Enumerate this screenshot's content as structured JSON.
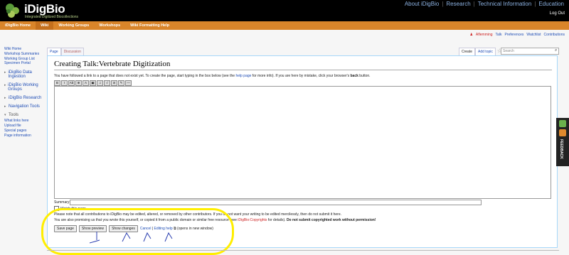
{
  "header": {
    "logo_text": "iDigBio",
    "logo_sub": "Integrated Digitized Biocollections",
    "links": [
      "About iDigBio",
      "Research",
      "Technical Information",
      "Education"
    ],
    "logout": "Log Out"
  },
  "nav": {
    "items": [
      "iDigBio Home",
      "Wiki",
      "Working Groups",
      "Workshops",
      "Wiki Formatting Help"
    ],
    "active": "Wiki"
  },
  "personal": {
    "user": "Aflemming",
    "talk": "Talk",
    "preferences": "Preferences",
    "watchlist": "Watchlist",
    "contributions": "Contributions"
  },
  "sidebar": {
    "links": [
      "Wiki Home",
      "Workshop Summaries",
      "Working Group List",
      "Specimen Portal"
    ],
    "sections": [
      "iDigBio Data Ingestion",
      "iDigBio Working Groups",
      "iDigBio Research",
      "Navigation Tools"
    ],
    "tools_label": "Tools",
    "tools": [
      "What links here",
      "Upload file",
      "Special pages",
      "Page information"
    ]
  },
  "tabs": {
    "page": "Page",
    "discussion": "Discussion",
    "create": "Create",
    "add_topic": "Add topic"
  },
  "search": {
    "placeholder": "Search"
  },
  "content": {
    "title": "Creating Talk:Vertebrate Digitization",
    "intro_before": "You have followed a link to a page that does not exist yet. To create the page, start typing in the box below (see the ",
    "intro_link": "help page",
    "intro_after": " for more info). If you are here by mistake, click your browser's ",
    "intro_bold": "back",
    "intro_end": " button.",
    "summary_label": "Summary:",
    "watch_label": "Watch this page",
    "notice1": "Please note that all contributions to iDigBio may be edited, altered, or removed by other contributors. If you do not want your writing to be edited mercilessly, then do not submit it here.",
    "notice2_before": "You are also promising us that you wrote this yourself, or copied it from a public domain or similar free resource (see ",
    "notice2_link": "iDigBio:Copyrights",
    "notice2_mid": " for details). ",
    "notice2_bold": "Do not submit copyrighted work without permission!"
  },
  "buttons": {
    "save": "Save page",
    "preview": "Show preview",
    "changes": "Show changes",
    "cancel": "Cancel",
    "sep": "|",
    "help": "Editing help",
    "help_note": "(opens in new window)"
  },
  "feedback": {
    "label": "FEEDBACK"
  },
  "colors": {
    "accent_orange": "#d9852a",
    "highlight_yellow": "#ffee00",
    "link_blue": "#1f4db5"
  }
}
